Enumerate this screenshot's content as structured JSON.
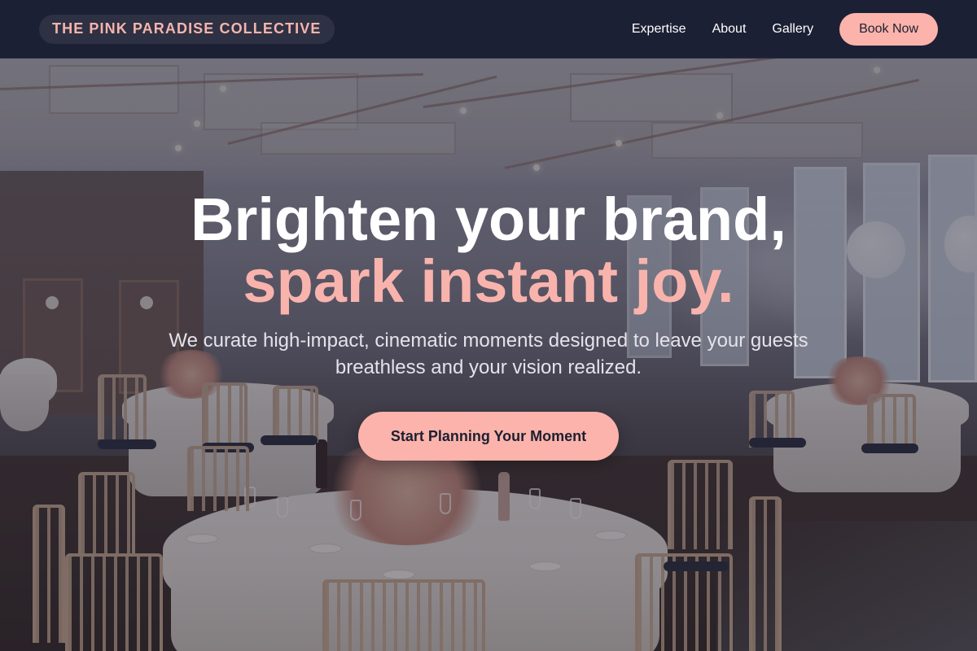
{
  "navbar": {
    "brand": "THE PINK PARADISE COLLECTIVE",
    "links": [
      {
        "label": "Expertise"
      },
      {
        "label": "About"
      },
      {
        "label": "Gallery"
      }
    ],
    "book_label": "Book Now"
  },
  "hero": {
    "headline_line1": "Brighten your brand,",
    "headline_line2": "spark instant joy.",
    "subtext": "We curate high-impact, cinematic moments designed to leave your guests breathless and your vision realized.",
    "cta_label": "Start Planning Your Moment",
    "background_image": "banquet-hall-photo"
  },
  "colors": {
    "accent": "#fbb3ab",
    "navbar_bg": "#1c2034",
    "text_dark": "#1d2031"
  }
}
